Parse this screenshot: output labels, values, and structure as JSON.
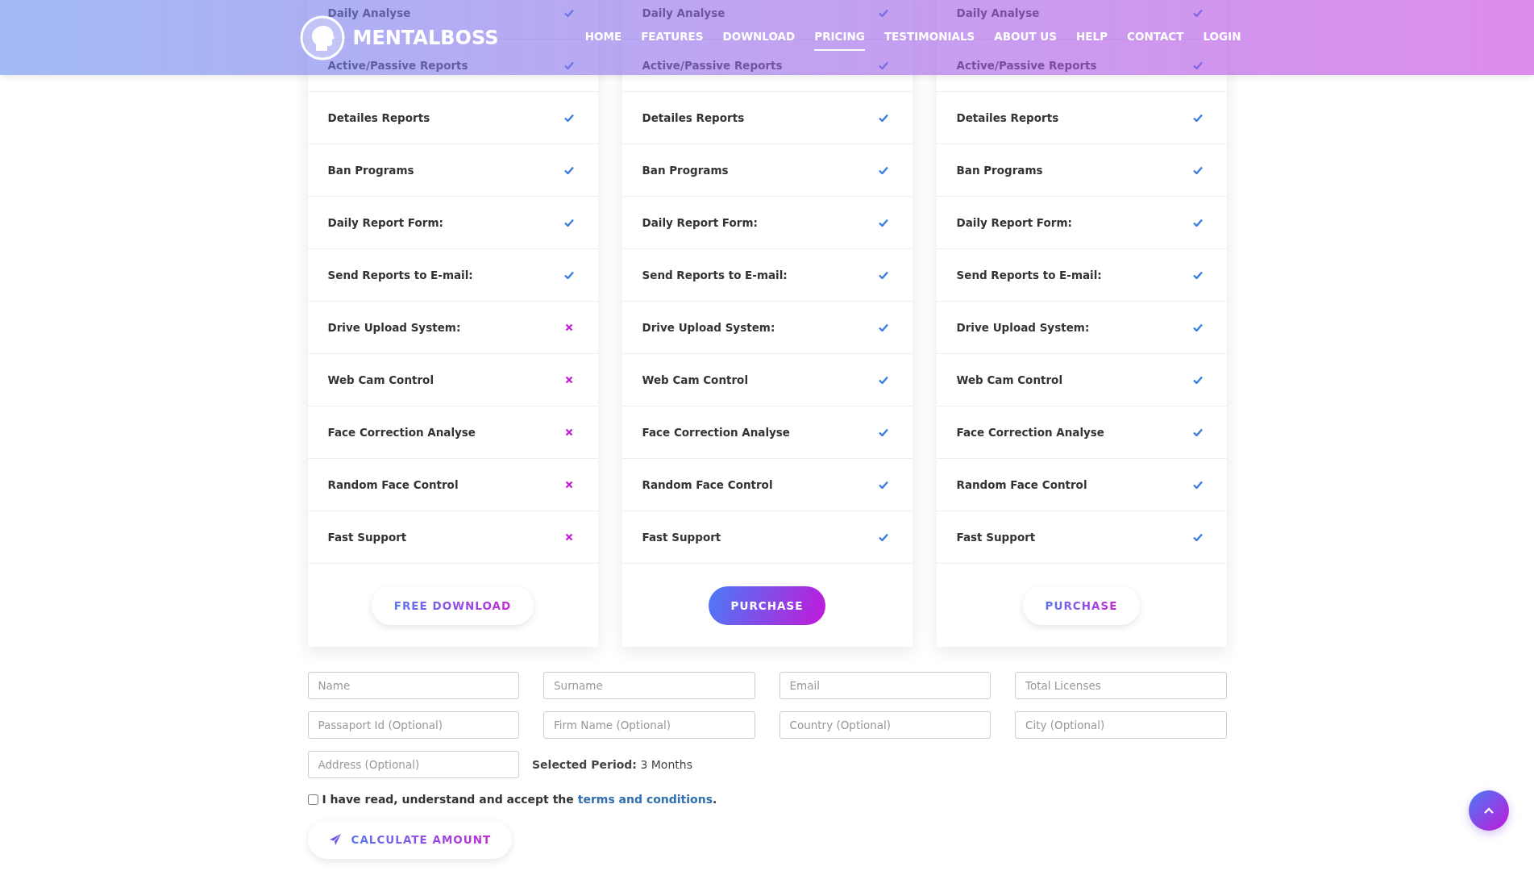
{
  "header": {
    "brand": "MENTALBOSS",
    "nav": [
      {
        "label": "HOME",
        "selected": false
      },
      {
        "label": "FEATURES",
        "selected": false
      },
      {
        "label": "DOWNLOAD",
        "selected": false
      },
      {
        "label": "PRICING",
        "selected": true
      },
      {
        "label": "TESTIMONIALS",
        "selected": false
      },
      {
        "label": "ABOUT US",
        "selected": false
      },
      {
        "label": "HELP",
        "selected": false
      },
      {
        "label": "CONTACT",
        "selected": false
      },
      {
        "label": "LOGIN",
        "selected": false
      }
    ]
  },
  "plans": [
    {
      "features": [
        {
          "label": "Daily Analyse",
          "included": true
        },
        {
          "label": "Active/Passive Reports",
          "included": true
        },
        {
          "label": "Detailes Reports",
          "included": true
        },
        {
          "label": "Ban Programs",
          "included": true
        },
        {
          "label": "Daily Report Form:",
          "included": true
        },
        {
          "label": "Send Reports to E-mail:",
          "included": true
        },
        {
          "label": "Drive Upload System:",
          "included": false
        },
        {
          "label": "Web Cam Control",
          "included": false
        },
        {
          "label": "Face Correction Analyse",
          "included": false
        },
        {
          "label": "Random Face Control",
          "included": false
        },
        {
          "label": "Fast Support",
          "included": false
        }
      ],
      "button": {
        "label": "FREE DOWNLOAD",
        "kind": "outline"
      }
    },
    {
      "features": [
        {
          "label": "Daily Analyse",
          "included": true
        },
        {
          "label": "Active/Passive Reports",
          "included": true
        },
        {
          "label": "Detailes Reports",
          "included": true
        },
        {
          "label": "Ban Programs",
          "included": true
        },
        {
          "label": "Daily Report Form:",
          "included": true
        },
        {
          "label": "Send Reports to E-mail:",
          "included": true
        },
        {
          "label": "Drive Upload System:",
          "included": true
        },
        {
          "label": "Web Cam Control",
          "included": true
        },
        {
          "label": "Face Correction Analyse",
          "included": true
        },
        {
          "label": "Random Face Control",
          "included": true
        },
        {
          "label": "Fast Support",
          "included": true
        }
      ],
      "button": {
        "label": "PURCHASE",
        "kind": "filled"
      }
    },
    {
      "features": [
        {
          "label": "Daily Analyse",
          "included": true
        },
        {
          "label": "Active/Passive Reports",
          "included": true
        },
        {
          "label": "Detailes Reports",
          "included": true
        },
        {
          "label": "Ban Programs",
          "included": true
        },
        {
          "label": "Daily Report Form:",
          "included": true
        },
        {
          "label": "Send Reports to E-mail:",
          "included": true
        },
        {
          "label": "Drive Upload System:",
          "included": true
        },
        {
          "label": "Web Cam Control",
          "included": true
        },
        {
          "label": "Face Correction Analyse",
          "included": true
        },
        {
          "label": "Random Face Control",
          "included": true
        },
        {
          "label": "Fast Support",
          "included": true
        }
      ],
      "button": {
        "label": "PURCHASE",
        "kind": "outline"
      }
    }
  ],
  "form": {
    "fields": [
      {
        "placeholder": "Name"
      },
      {
        "placeholder": "Surname"
      },
      {
        "placeholder": "Email"
      },
      {
        "placeholder": "Total Licenses"
      },
      {
        "placeholder": "Passaport Id (Optional)"
      },
      {
        "placeholder": "Firm Name (Optional)"
      },
      {
        "placeholder": "Country (Optional)"
      },
      {
        "placeholder": "City (Optional)"
      },
      {
        "placeholder": "Address (Optional)"
      }
    ],
    "period": "**Selected Period:** 3 Months",
    "agreement": {
      "checked": false,
      "text": "I have read, understand and accept the",
      "link": "terms and conditions",
      "suffix": "."
    },
    "submit": "CALCULATE AMOUNT"
  }
}
